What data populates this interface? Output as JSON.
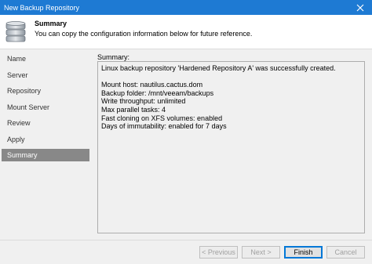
{
  "window": {
    "title": "New Backup Repository"
  },
  "header": {
    "title": "Summary",
    "subtitle": "You can copy the configuration information below for future reference.",
    "icon": "database-icon"
  },
  "steps": [
    {
      "label": "Name",
      "active": false
    },
    {
      "label": "Server",
      "active": false
    },
    {
      "label": "Repository",
      "active": false
    },
    {
      "label": "Mount Server",
      "active": false
    },
    {
      "label": "Review",
      "active": false
    },
    {
      "label": "Apply",
      "active": false
    },
    {
      "label": "Summary",
      "active": true
    }
  ],
  "summary": {
    "label": "Summary:",
    "lines": [
      "Linux backup repository 'Hardened Repository A' was successfully created.",
      "Mount host: nautilus.cactus.dom",
      "Backup folder: /mnt/veeam/backups",
      "Write throughput: unlimited",
      "Max parallel tasks: 4",
      "Fast cloning on XFS volumes: enabled",
      "Days of immutability: enabled for 7 days"
    ]
  },
  "buttons": {
    "previous": "< Previous",
    "next": "Next >",
    "finish": "Finish",
    "cancel": "Cancel"
  },
  "colors": {
    "titlebar": "#1e7ad3",
    "active_step": "#888888",
    "accent": "#0078d7"
  }
}
